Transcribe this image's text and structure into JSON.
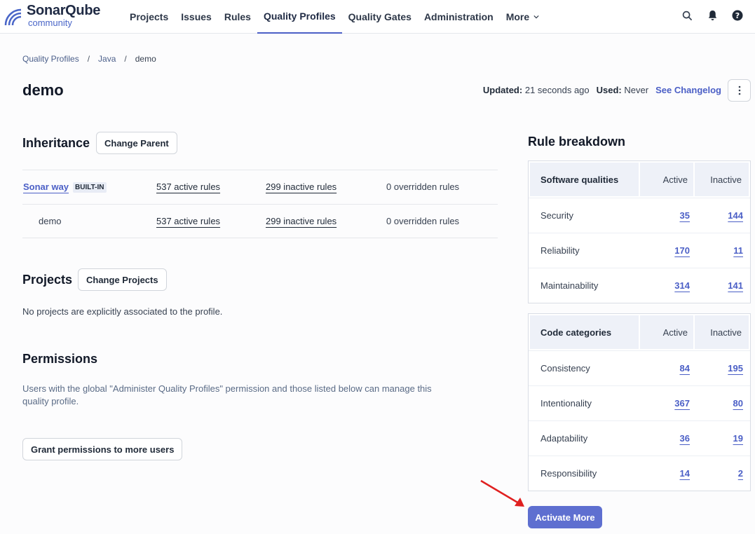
{
  "brand": {
    "name": "SonarQube",
    "edition": "community"
  },
  "nav": {
    "items": [
      "Projects",
      "Issues",
      "Rules",
      "Quality Profiles",
      "Quality Gates",
      "Administration",
      "More"
    ],
    "active": "Quality Profiles"
  },
  "breadcrumb": {
    "items": [
      "Quality Profiles",
      "Java",
      "demo"
    ],
    "separator": "/"
  },
  "profile": {
    "name": "demo",
    "updated_label": "Updated:",
    "updated_value": "21 seconds ago",
    "used_label": "Used:",
    "used_value": "Never",
    "changelog_label": "See Changelog"
  },
  "inheritance": {
    "title": "Inheritance",
    "change_parent_label": "Change Parent",
    "rows": [
      {
        "name": "Sonar way",
        "badge": "BUILT-IN",
        "active": "537 active rules",
        "inactive": "299 inactive rules",
        "overridden": "0 overridden rules"
      },
      {
        "name": "demo",
        "active": "537 active rules",
        "inactive": "299 inactive rules",
        "overridden": "0 overridden rules"
      }
    ]
  },
  "projects": {
    "title": "Projects",
    "change_projects_label": "Change Projects",
    "empty_text": "No projects are explicitly associated to the profile."
  },
  "permissions": {
    "title": "Permissions",
    "description": "Users with the global \"Administer Quality Profiles\" permission and those listed below can manage this quality profile.",
    "grant_label": "Grant permissions to more users"
  },
  "rule_breakdown": {
    "title": "Rule breakdown",
    "software_qualities": {
      "header": [
        "Software qualities",
        "Active",
        "Inactive"
      ],
      "rows": [
        {
          "name": "Security",
          "active": "35",
          "inactive": "144"
        },
        {
          "name": "Reliability",
          "active": "170",
          "inactive": "11"
        },
        {
          "name": "Maintainability",
          "active": "314",
          "inactive": "141"
        }
      ]
    },
    "code_categories": {
      "header": [
        "Code categories",
        "Active",
        "Inactive"
      ],
      "rows": [
        {
          "name": "Consistency",
          "active": "84",
          "inactive": "195"
        },
        {
          "name": "Intentionality",
          "active": "367",
          "inactive": "80"
        },
        {
          "name": "Adaptability",
          "active": "36",
          "inactive": "19"
        },
        {
          "name": "Responsibility",
          "active": "14",
          "inactive": "2"
        }
      ]
    },
    "activate_more_label": "Activate More"
  },
  "colors": {
    "accent": "#5e6fd0",
    "link": "#4b5fc6",
    "annotation_arrow": "#e02020"
  }
}
